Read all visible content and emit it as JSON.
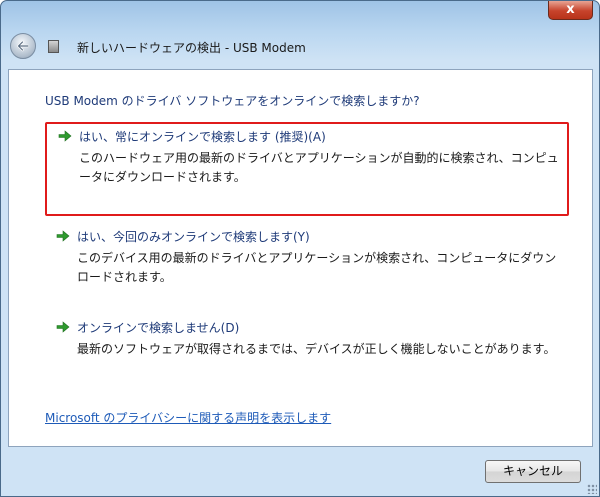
{
  "window": {
    "title": "新しいハードウェアの検出 - USB Modem",
    "close_label": "x"
  },
  "question": "USB Modem のドライバ ソフトウェアをオンラインで検索しますか?",
  "options": [
    {
      "title": "はい、常にオンラインで検索します (推奨)(A)",
      "description": "このハードウェア用の最新のドライバとアプリケーションが自動的に検索され、コンピュータにダウンロードされます。",
      "selected": true
    },
    {
      "title": "はい、今回のみオンラインで検索します(Y)",
      "description": "このデバイス用の最新のドライバとアプリケーションが検索され、コンピュータにダウンロードされます。",
      "selected": false
    },
    {
      "title": "オンラインで検索しません(D)",
      "description": "最新のソフトウェアが取得されるまでは、デバイスが正しく機能しないことがあります。",
      "selected": false
    }
  ],
  "privacy_link": "Microsoft のプライバシーに関する声明を表示します",
  "cancel_label": "キャンセル",
  "colors": {
    "selection_border": "#e01b1b",
    "arrow_green": "#2e9a2e",
    "link_blue": "#1e5bb8",
    "heading_blue": "#1e3a78"
  }
}
